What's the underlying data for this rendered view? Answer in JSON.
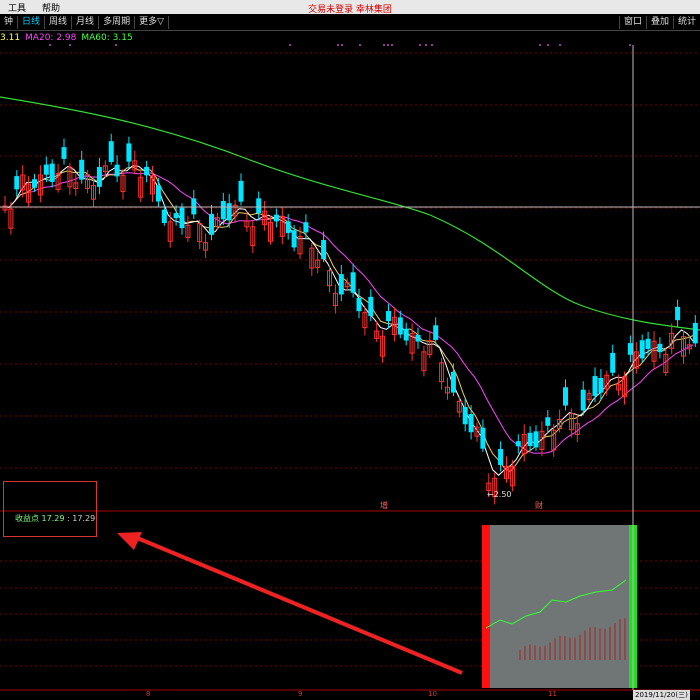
{
  "menu": {
    "items": [
      "工具",
      "帮助"
    ],
    "title": "交易未登录 幸林集团"
  },
  "toolbar": {
    "items": [
      "钟",
      "日线",
      "周线",
      "月线",
      "多周期",
      "更多"
    ],
    "more_arrow": "▽",
    "active_index": 1,
    "right_items": [
      "窗口",
      "叠加",
      "统计"
    ]
  },
  "ma": {
    "ma_cut": "3.11",
    "ma20": "MA20: 2.98",
    "ma60": "MA60: 3.15",
    "colors": {
      "ma_cut": "#ffff66",
      "ma20": "#ff44ff",
      "ma60": "#44ff44"
    }
  },
  "annotations": {
    "low_price": "2.50",
    "marker_left": "增",
    "marker_right": "财",
    "gain_label": "收益点",
    "gain_value1": "17.29",
    "gain_value2": "17.29",
    "date_badge": "2019/11/20(三)",
    "x_labels": [
      "8",
      "9",
      "10",
      "11"
    ]
  },
  "colors": {
    "up": "#ff3030",
    "down": "#00e5ff",
    "grid": "#7a0000",
    "crosshair": "#bbbbbb"
  }
}
